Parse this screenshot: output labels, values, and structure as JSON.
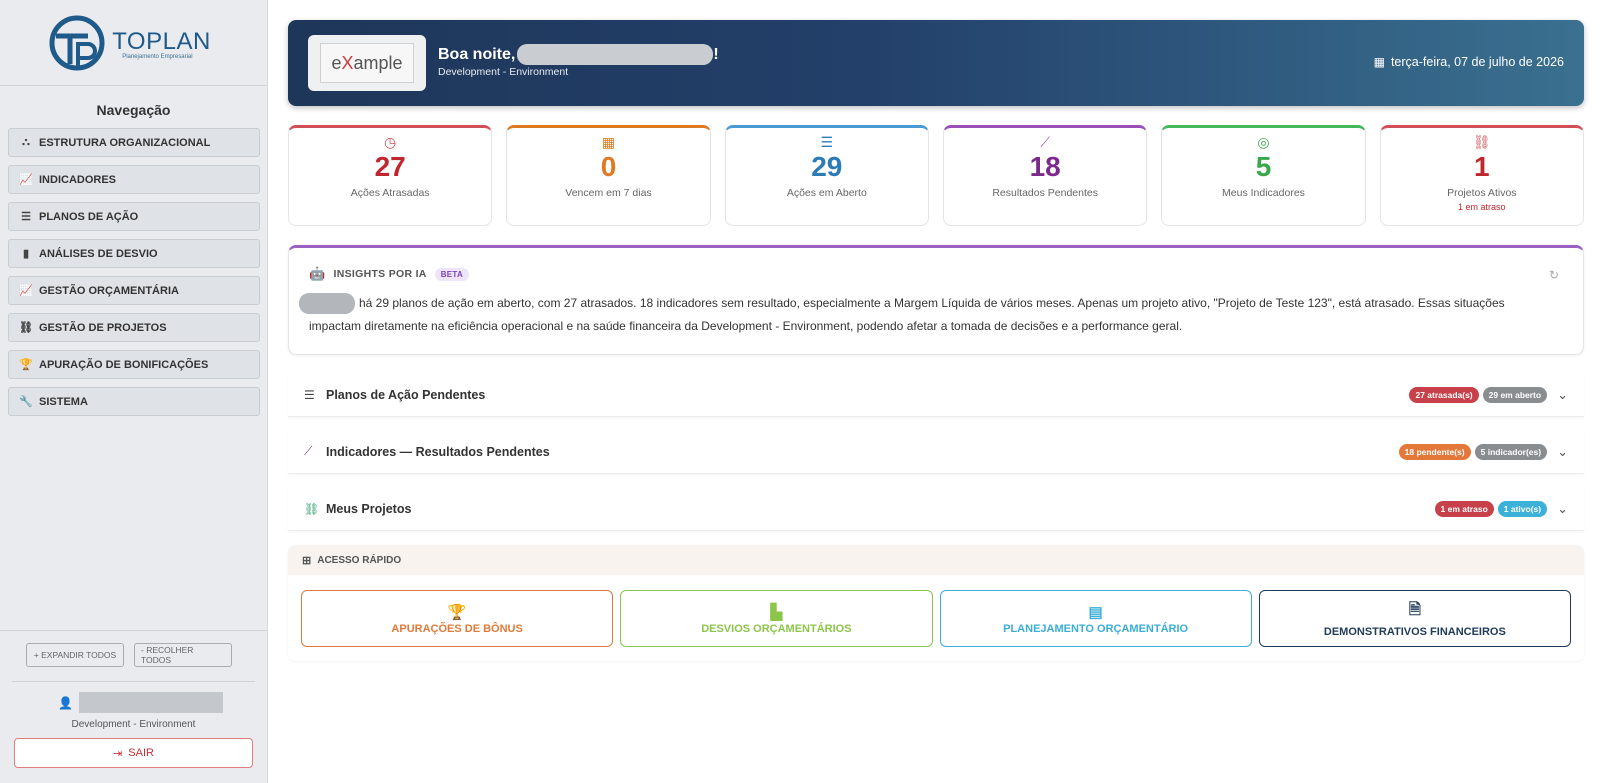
{
  "brand": {
    "name": "TOPLAN",
    "tagline": "Planejamento Empresarial",
    "mark": "TP"
  },
  "sidebar": {
    "title": "Navegação",
    "items": [
      {
        "label": "ESTRUTURA ORGANIZACIONAL",
        "icon": "sitemap-icon"
      },
      {
        "label": "INDICADORES",
        "icon": "chart-line-icon"
      },
      {
        "label": "PLANOS DE AÇÃO",
        "icon": "list-check-icon"
      },
      {
        "label": "ANÁLISES DE DESVIO",
        "icon": "clipboard-icon"
      },
      {
        "label": "GESTÃO ORÇAMENTÁRIA",
        "icon": "chart-line-icon"
      },
      {
        "label": "GESTÃO DE PROJETOS",
        "icon": "project-diagram-icon"
      },
      {
        "label": "APURAÇÃO DE BONIFICAÇÕES",
        "icon": "trophy-icon"
      },
      {
        "label": "SISTEMA",
        "icon": "wrench-icon"
      }
    ],
    "expand_label": "+ EXPANDIR TODOS",
    "collapse_label": "- RECOLHER TODOS",
    "user_env": "Development - Environment",
    "logout_label": "SAIR"
  },
  "hero": {
    "logo_text_pre": "e",
    "logo_text_x": "X",
    "logo_text_post": "ample",
    "greeting": "Boa noite,",
    "greeting_end": "!",
    "env": "Development - Environment",
    "date": "terça-feira, 07 de julho de 2026"
  },
  "stats": [
    {
      "value": "27",
      "label": "Ações Atrasadas",
      "color": "#c0262e",
      "icon": "clock-icon"
    },
    {
      "value": "0",
      "label": "Vencem em 7 dias",
      "color": "#e07a22",
      "icon": "calendar-icon"
    },
    {
      "value": "29",
      "label": "Ações em Aberto",
      "color": "#2b7bb8",
      "icon": "list-check-icon"
    },
    {
      "value": "18",
      "label": "Resultados Pendentes",
      "color": "#7b2a8c",
      "icon": "chart-line-icon"
    },
    {
      "value": "5",
      "label": "Meus Indicadores",
      "color": "#3aa84a",
      "icon": "target-icon"
    },
    {
      "value": "1",
      "label": "Projetos Ativos",
      "sub": "1 em atraso",
      "color": "#c0262e",
      "icon": "project-diagram-icon"
    }
  ],
  "insights": {
    "title": "INSIGHTS POR IA",
    "badge": "BETA",
    "text": "há 29 planos de ação em aberto, com 27 atrasados. 18 indicadores sem resultado, especialmente a Margem Líquida de vários meses. Apenas um projeto ativo, \"Projeto de Teste 123\", está atrasado. Essas situações impactam diretamente na eficiência operacional e na saúde financeira da Development - Environment, podendo afetar a tomada de decisões e a performance geral."
  },
  "accordions": [
    {
      "title": "Planos de Ação Pendentes",
      "icon": "list-check-icon",
      "badges": [
        {
          "text": "27 atrasada(s)",
          "color": "#c8414a"
        },
        {
          "text": "29 em aberto",
          "color": "#8a8d90"
        }
      ]
    },
    {
      "title": "Indicadores — Resultados Pendentes",
      "icon": "chart-line-icon",
      "badges": [
        {
          "text": "18 pendente(s)",
          "color": "#e4773a"
        },
        {
          "text": "5 indicador(es)",
          "color": "#8a8d90"
        }
      ]
    },
    {
      "title": "Meus Projetos",
      "icon": "project-diagram-icon",
      "badges": [
        {
          "text": "1 em atraso",
          "color": "#c8414a"
        },
        {
          "text": "1 ativo(s)",
          "color": "#3bb0d8"
        }
      ]
    }
  ],
  "quick": {
    "title": "ACESSO RÁPIDO",
    "buttons": [
      {
        "label": "APURAÇÕES DE BÔNUS",
        "color": "#e07a3a",
        "icon": "trophy-icon"
      },
      {
        "label": "DESVIOS ORÇAMENTÁRIOS",
        "color": "#8cc54a",
        "icon": "chart-bar-icon"
      },
      {
        "label": "PLANEJAMENTO ORÇAMENTÁRIO",
        "color": "#3aaed6",
        "icon": "calculator-icon"
      },
      {
        "label": "DEMONSTRATIVOS FINANCEIROS",
        "color": "#223b5a",
        "icon": "file-invoice-dollar-icon"
      }
    ]
  }
}
